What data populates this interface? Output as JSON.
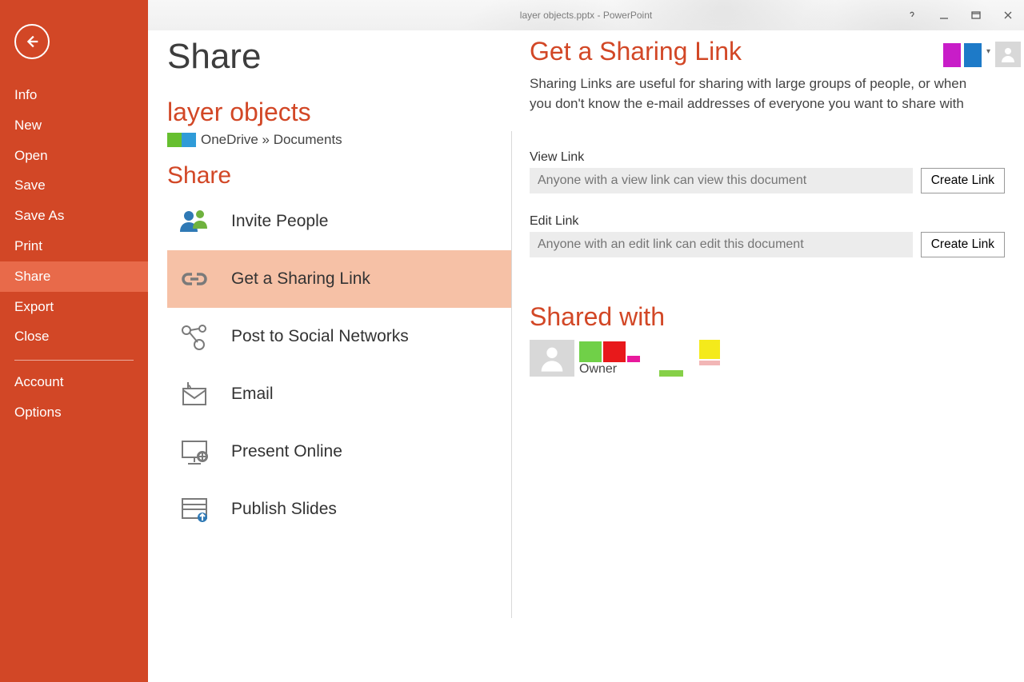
{
  "title": "layer objects.pptx - PowerPoint",
  "sidebar": {
    "items": [
      {
        "label": "Info"
      },
      {
        "label": "New"
      },
      {
        "label": "Open"
      },
      {
        "label": "Save"
      },
      {
        "label": "Save As"
      },
      {
        "label": "Print"
      },
      {
        "label": "Share"
      },
      {
        "label": "Export"
      },
      {
        "label": "Close"
      }
    ],
    "secondary": [
      {
        "label": "Account"
      },
      {
        "label": "Options"
      }
    ]
  },
  "page_heading": "Share",
  "doc": {
    "name": "layer objects",
    "location": "OneDrive » Documents"
  },
  "share_options_heading": "Share",
  "share_options": [
    {
      "label": "Invite People"
    },
    {
      "label": "Get a Sharing Link"
    },
    {
      "label": "Post to Social Networks"
    },
    {
      "label": "Email"
    },
    {
      "label": "Present Online"
    },
    {
      "label": "Publish Slides"
    }
  ],
  "right": {
    "heading": "Get a Sharing Link",
    "desc": "Sharing Links are useful for sharing with large groups of people, or when you don't know the e-mail addresses of everyone you want to share with",
    "view_link_label": "View Link",
    "view_link_placeholder": "Anyone with a view link can view this document",
    "edit_link_label": "Edit Link",
    "edit_link_placeholder": "Anyone with an edit link can edit this document",
    "create_btn": "Create Link",
    "shared_with_heading": "Shared with",
    "owner_label": "Owner"
  }
}
